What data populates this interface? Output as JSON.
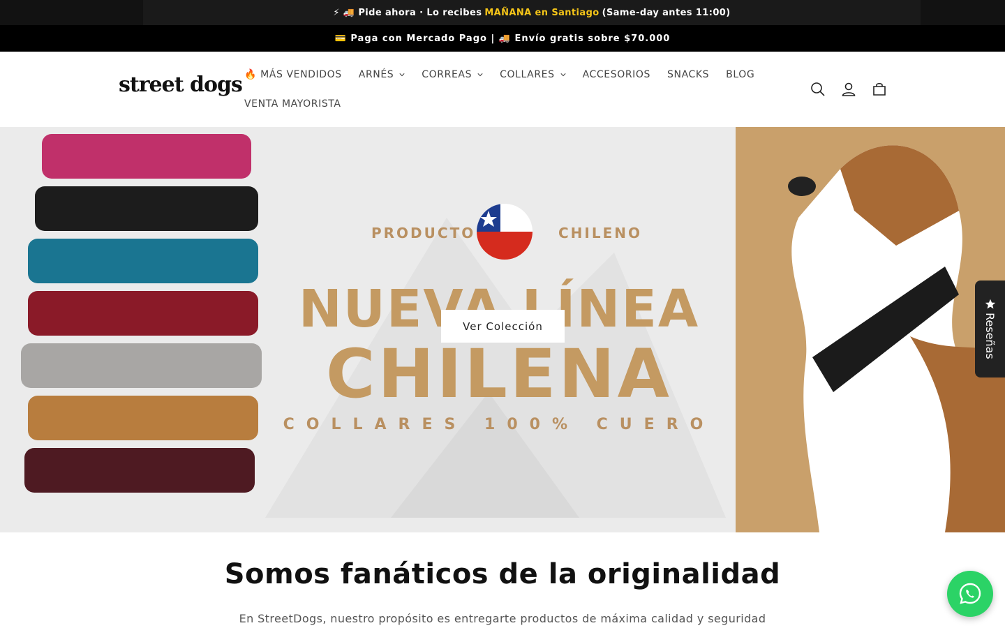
{
  "announcement": {
    "part1": "⚡ 🚚 Pide ahora · Lo recibes",
    "highlight": "MAÑANA en Santiago",
    "part2": "(Same-day antes 11:00)",
    "highlight_color": "#f5c518"
  },
  "payment_bar": {
    "text": "💳 Paga con Mercado Pago | 🚚 Envío gratis sobre $70.000"
  },
  "header": {
    "logo_text": "street dogs",
    "nav": [
      {
        "label": "🔥 MÁS VENDIDOS",
        "dropdown": false
      },
      {
        "label": "ARNÉS",
        "dropdown": true
      },
      {
        "label": "CORREAS",
        "dropdown": true
      },
      {
        "label": "COLLARES",
        "dropdown": true
      },
      {
        "label": "ACCESORIOS",
        "dropdown": false
      },
      {
        "label": "SNACKS",
        "dropdown": false
      },
      {
        "label": "BLOG",
        "dropdown": false
      },
      {
        "label": "VENTA MAYORISTA",
        "dropdown": false
      }
    ],
    "icons": [
      "search-icon",
      "account-icon",
      "cart-icon"
    ]
  },
  "hero": {
    "producto_left": "PRODUCTO",
    "producto_right": "CHILENO",
    "headline1": "NUEVA LÍNEA",
    "headline2": "CHILENA",
    "subline": "COLLARES 100% CUERO",
    "cta_label": "Ver Colección",
    "accent_color": "#c49a62"
  },
  "reviews_tab": {
    "label": "Reseñas"
  },
  "intro": {
    "title": "Somos fanáticos de la originalidad",
    "text": "En StreetDogs, nuestro propósito es entregarte productos de máxima calidad y seguridad"
  },
  "whatsapp": {
    "icon": "whatsapp-icon",
    "color": "#2bd366"
  }
}
